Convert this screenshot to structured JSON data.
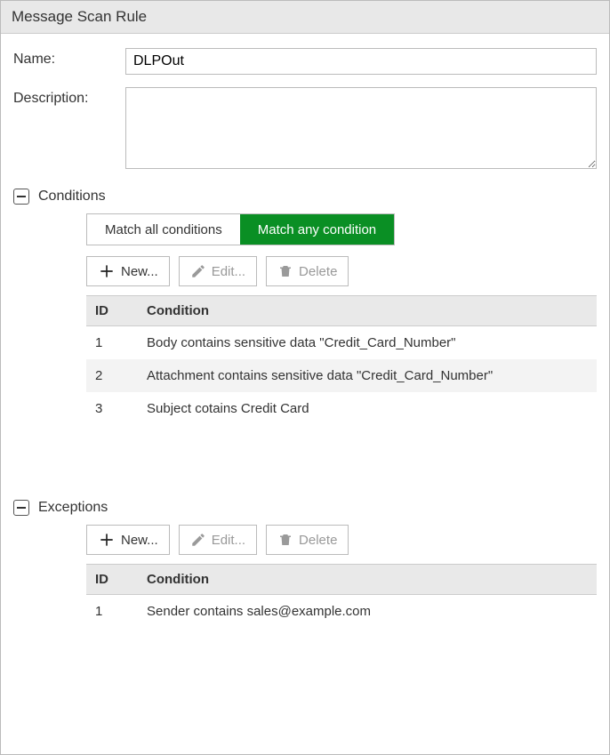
{
  "panel": {
    "title": "Message Scan Rule"
  },
  "fields": {
    "name_label": "Name:",
    "name_value": "DLPOut",
    "desc_label": "Description:",
    "desc_value": ""
  },
  "conditions": {
    "title": "Conditions",
    "match_all_label": "Match all conditions",
    "match_any_label": "Match any condition",
    "match_active": "any",
    "toolbar": {
      "new": "New...",
      "edit": "Edit...",
      "delete": "Delete"
    },
    "headers": {
      "id": "ID",
      "condition": "Condition"
    },
    "rows": [
      {
        "id": "1",
        "text": "Body contains sensitive data \"Credit_Card_Number\""
      },
      {
        "id": "2",
        "text": "Attachment contains sensitive data \"Credit_Card_Number\""
      },
      {
        "id": "3",
        "text": "Subject cotains Credit Card"
      }
    ]
  },
  "exceptions": {
    "title": "Exceptions",
    "toolbar": {
      "new": "New...",
      "edit": "Edit...",
      "delete": "Delete"
    },
    "headers": {
      "id": "ID",
      "condition": "Condition"
    },
    "rows": [
      {
        "id": "1",
        "text": "Sender contains sales@example.com"
      }
    ]
  }
}
